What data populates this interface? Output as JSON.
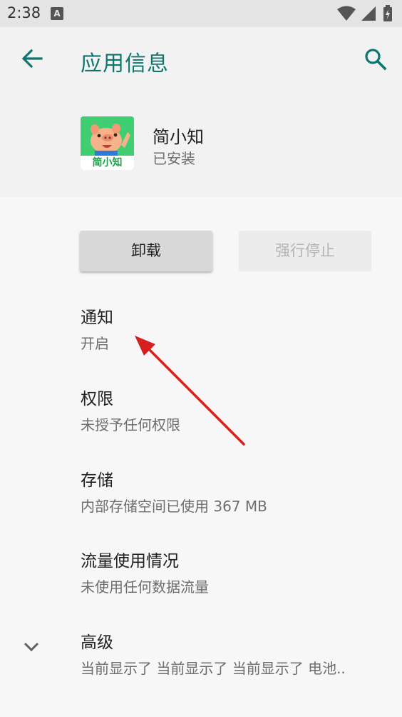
{
  "status_bar": {
    "time": "2:38",
    "notification_badge": "A",
    "icons": [
      "wifi-icon",
      "signal-icon",
      "battery-icon"
    ]
  },
  "app_bar": {
    "title": "应用信息",
    "back_icon": "arrow-back-icon",
    "search_icon": "search-icon",
    "accent_color": "#0f766e"
  },
  "app_header": {
    "name": "简小知",
    "status": "已安装",
    "icon_label": "简小知",
    "icon_color": "#3fcf72"
  },
  "actions": {
    "uninstall_label": "卸载",
    "force_stop_label": "强行停止"
  },
  "preferences": [
    {
      "title": "通知",
      "summary": "开启"
    },
    {
      "title": "权限",
      "summary": "未授予任何权限"
    },
    {
      "title": "存储",
      "summary": "内部存储空间已使用 367 MB"
    },
    {
      "title": "流量使用情况",
      "summary": "未使用任何数据流量"
    },
    {
      "title": "高级",
      "summary": "当前显示了 当前显示了 当前显示了 电池.."
    }
  ],
  "annotation": {
    "arrow_color": "#d42020"
  }
}
